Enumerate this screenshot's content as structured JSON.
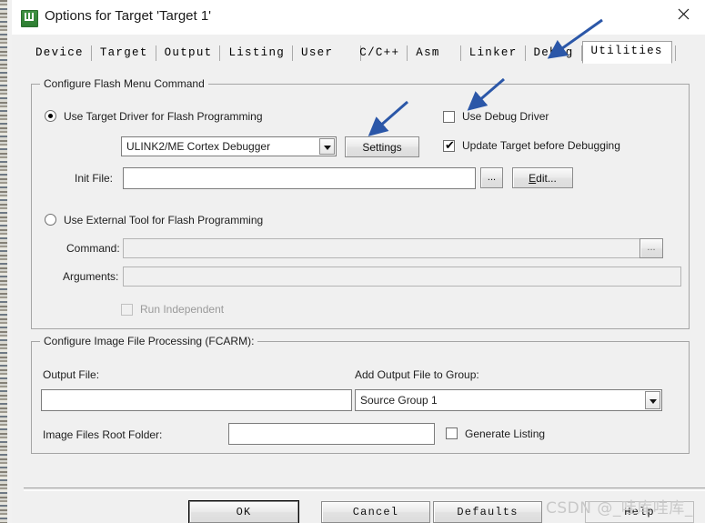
{
  "window": {
    "title": "Options for Target 'Target 1'",
    "icon": "keil-uvision-icon",
    "close_label": "✕"
  },
  "tabs": [
    {
      "label": "Device",
      "active": false
    },
    {
      "label": "Target",
      "active": false
    },
    {
      "label": "Output",
      "active": false
    },
    {
      "label": "Listing",
      "active": false
    },
    {
      "label": "User",
      "active": false
    },
    {
      "label": "C/C++",
      "active": false
    },
    {
      "label": "Asm",
      "active": false
    },
    {
      "label": "Linker",
      "active": false
    },
    {
      "label": "Debug",
      "active": false
    },
    {
      "label": "Utilities",
      "active": true
    }
  ],
  "flash_group": {
    "legend": "Configure Flash Menu Command",
    "use_target_driver": {
      "label": "Use Target Driver for Flash Programming",
      "selected": true
    },
    "driver_combo": {
      "value": "ULINK2/ME Cortex Debugger"
    },
    "settings_button": "Settings",
    "use_debug_driver": {
      "label": "Use Debug Driver",
      "checked": false
    },
    "update_target": {
      "label": "Update Target before Debugging",
      "checked": true
    },
    "init_file": {
      "label": "Init File:",
      "value": "",
      "browse_button": "...",
      "edit_button_pre": "E",
      "edit_button_post": "dit..."
    },
    "use_external_tool": {
      "label": "Use External Tool for Flash Programming",
      "selected": false
    },
    "command": {
      "label": "Command:",
      "value": "",
      "browse_button": "..."
    },
    "arguments": {
      "label": "Arguments:",
      "value": ""
    },
    "run_independent": {
      "label": "Run Independent",
      "checked": false,
      "enabled": false
    }
  },
  "fcarm_group": {
    "legend": "Configure Image File Processing (FCARM):",
    "output_file": {
      "label": "Output File:",
      "value": ""
    },
    "add_output_group": {
      "label": "Add Output File  to Group:",
      "value": "Source Group 1"
    },
    "image_root": {
      "label": "Image Files Root Folder:",
      "value": ""
    },
    "generate_listing": {
      "label": "Generate Listing",
      "checked": false
    }
  },
  "footer": {
    "ok": "OK",
    "cancel": "Cancel",
    "defaults": "Defaults",
    "help": "Help"
  },
  "watermark": "CSDN @_哇库哇库_",
  "annotations": {
    "arrow_color": "#2b57a8",
    "arrows": [
      {
        "name": "arrow-to-utilities-tab"
      },
      {
        "name": "arrow-to-settings-button"
      },
      {
        "name": "arrow-to-use-debug-driver"
      }
    ]
  }
}
